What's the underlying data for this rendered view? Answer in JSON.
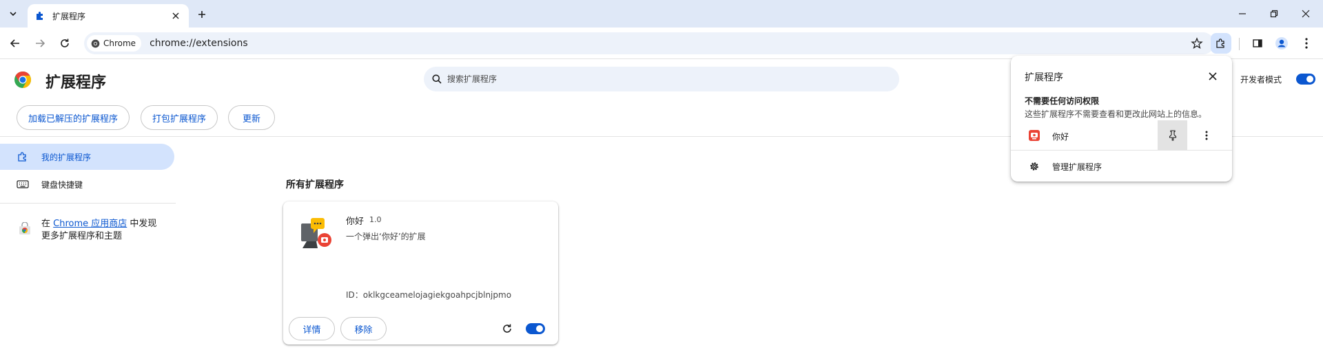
{
  "browser": {
    "tab": {
      "title": "扩展程序"
    },
    "omnibox": {
      "chip_label": "Chrome",
      "url": "chrome://extensions"
    }
  },
  "page": {
    "title": "扩展程序",
    "search_placeholder": "搜索扩展程序",
    "developer_mode": {
      "label": "开发者模式",
      "enabled": true
    },
    "buttons": {
      "load_unpacked": "加载已解压的扩展程序",
      "pack": "打包扩展程序",
      "update": "更新"
    }
  },
  "sidebar": {
    "items": [
      {
        "label": "我的扩展程序",
        "icon": "extension-puzzle-icon",
        "active": true
      },
      {
        "label": "键盘快捷键",
        "icon": "keyboard-icon",
        "active": false
      }
    ],
    "store": {
      "prefix": "在",
      "link": "Chrome 应用商店",
      "suffix": "中发现",
      "line2": "更多扩展程序和主题"
    }
  },
  "extensions": {
    "section_title": "所有扩展程序",
    "items": [
      {
        "name": "你好",
        "version": "1.0",
        "description": "一个弹出‘你好’的扩展",
        "id_text": "ID：oklkgceamelojagiekgoahpcjblnjpmo",
        "details_label": "详情",
        "remove_label": "移除",
        "enabled": true
      }
    ]
  },
  "popup": {
    "title": "扩展程序",
    "heading": "不需要任何访问权限",
    "subtext": "这些扩展程序不需要查看和更改此网站上的信息。",
    "extension_name": "你好",
    "manage_label": "管理扩展程序"
  },
  "colors": {
    "accent": "#0b57d0",
    "tabstrip_bg": "#dfe8f7",
    "active_nav_bg": "#d3e3fd",
    "omnibox_bg": "#edf2fa"
  }
}
